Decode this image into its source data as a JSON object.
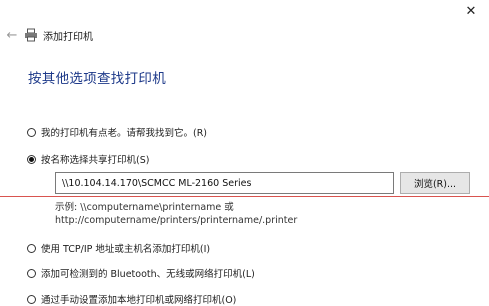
{
  "window": {
    "close_glyph": "✕",
    "back_glyph": "←",
    "title": "添加打印机"
  },
  "heading": "按其他选项查找打印机",
  "options": [
    {
      "label": "我的打印机有点老。请帮我找到它。(R)",
      "selected": false
    },
    {
      "label": "按名称选择共享打印机(S)",
      "selected": true
    },
    {
      "label": "使用 TCP/IP 地址或主机名添加打印机(I)",
      "selected": false
    },
    {
      "label": "添加可检测到的 Bluetooth、无线或网络打印机(L)",
      "selected": false
    },
    {
      "label": "通过手动设置添加本地打印机或网络打印机(O)",
      "selected": false
    }
  ],
  "share_input": {
    "value": "\\\\10.104.14.170\\SCMCC ML-2160 Series"
  },
  "browse_label": "浏览(R)...",
  "example": {
    "line1": "示例: \\\\computername\\printername 或",
    "line2": "http://computername/printers/printername/.printer"
  },
  "colors": {
    "heading": "#1e3a8a",
    "annotation_line": "#d9534f"
  },
  "icons": {
    "close": "close-icon",
    "back": "back-arrow-icon",
    "printer": "printer-icon"
  }
}
